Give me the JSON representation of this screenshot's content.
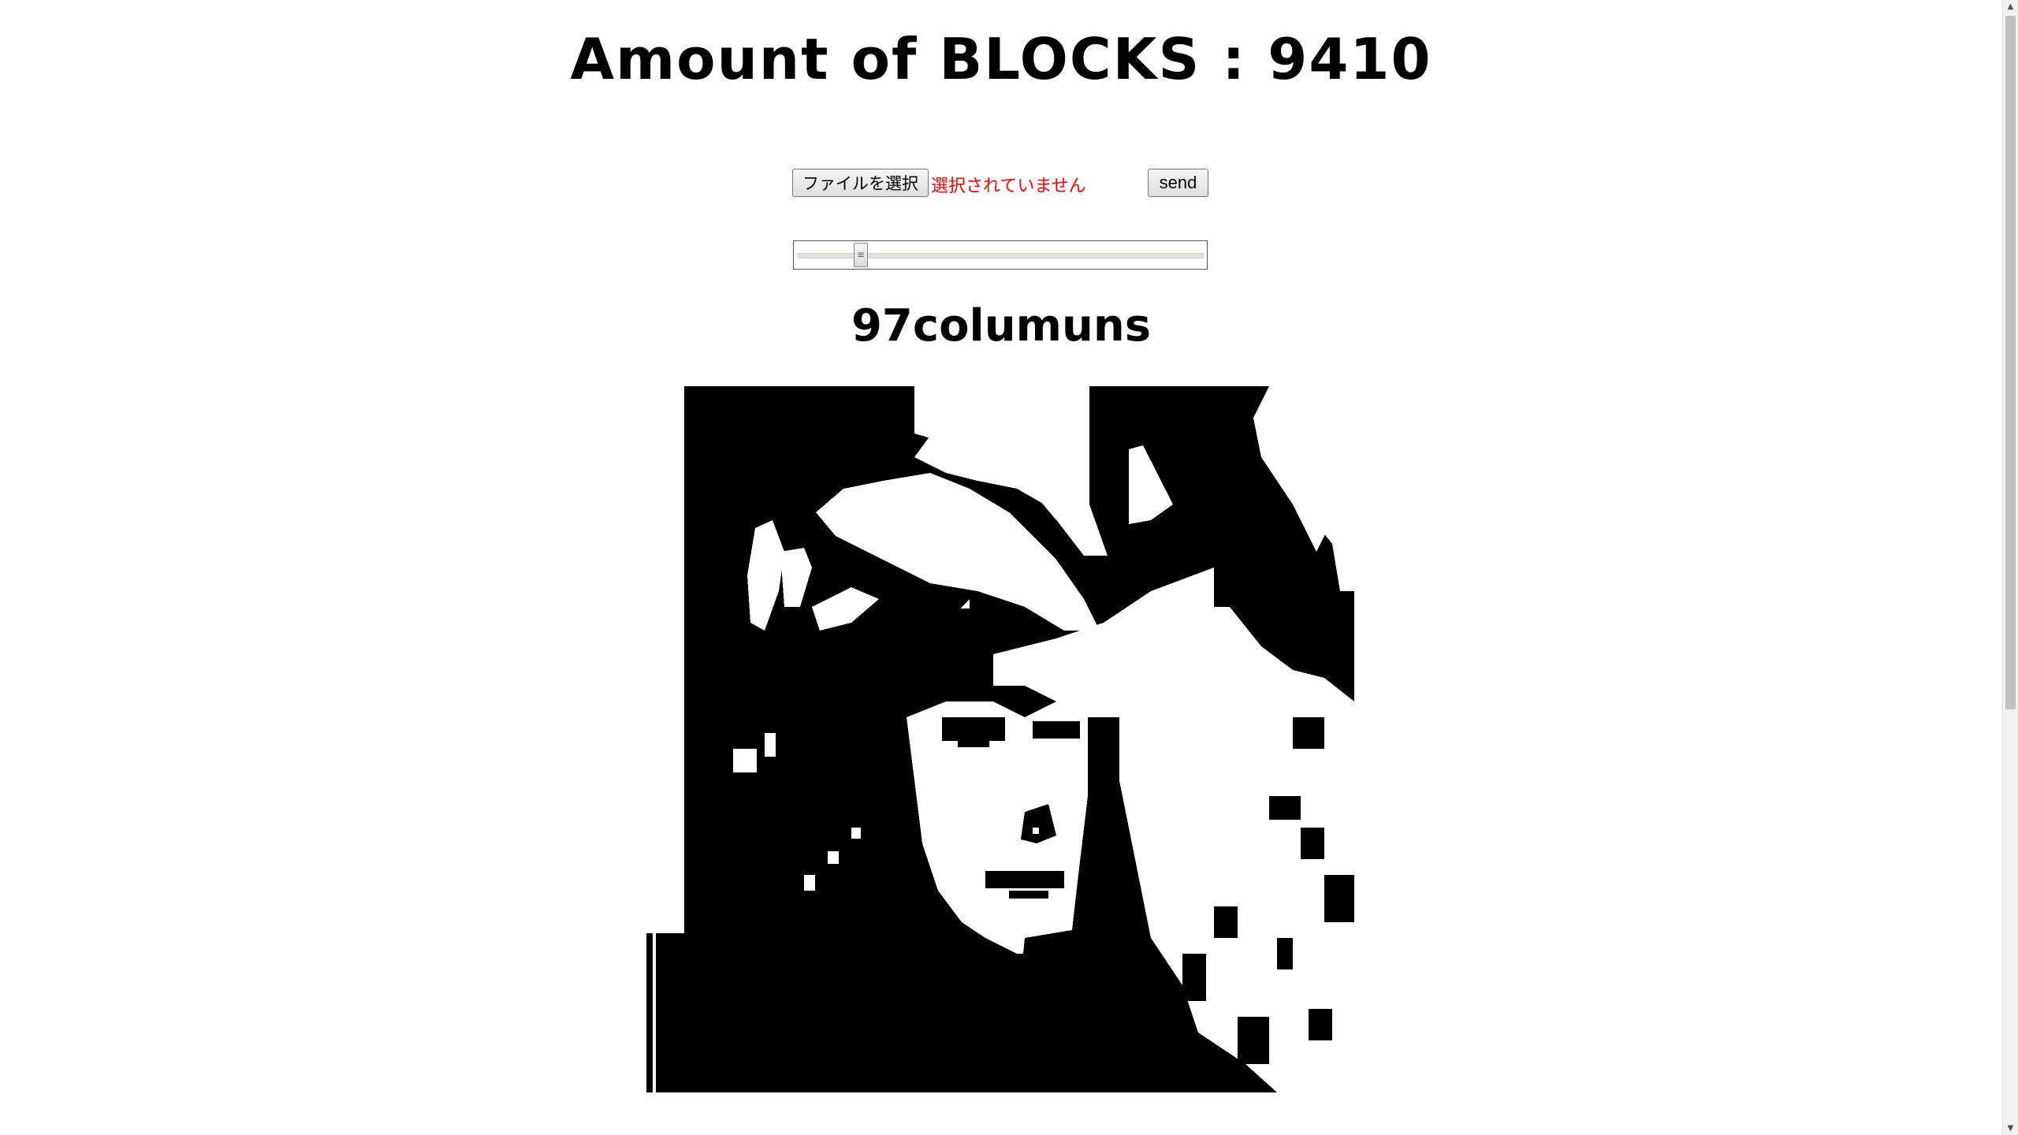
{
  "header": {
    "title": "Amount of BLOCKS : 9410"
  },
  "upload": {
    "file_button_label": "ファイルを選択",
    "file_status": "選択されていません",
    "send_label": "send"
  },
  "slider": {
    "fraction": 0.15
  },
  "columns": {
    "count": 97,
    "label": "97columuns"
  },
  "mosaic": {
    "colors": {
      "on": "#000000",
      "off": "#ffffff"
    }
  },
  "scrollbar": {
    "up_icon": "▲",
    "down_icon": "▼"
  }
}
